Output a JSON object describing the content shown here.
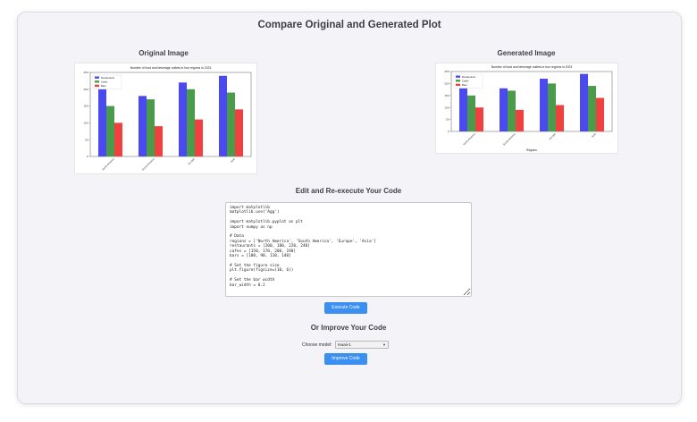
{
  "page": {
    "title": "Compare Original and Generated Plot"
  },
  "original": {
    "heading": "Original Image"
  },
  "generated": {
    "heading": "Generated Image"
  },
  "editor": {
    "heading": "Edit and Re-execute Your Code",
    "code": "import matplotlib\nmatplotlib.use('Agg')\n\nimport matplotlib.pyplot as plt\nimport numpy as np\n\n# Data\nregions = ['North America', 'South America', 'Europe', 'Asia']\nrestaurants = [200, 180, 220, 240]\ncafes = [150, 170, 200, 190]\nbars = [100, 90, 110, 140]\n\n# Set the figure size\nplt.figure(figsize=(10, 6))\n\n# Set the bar width\nbar_width = 0.2",
    "execute_label": "Execute Code"
  },
  "improve": {
    "heading": "Or Improve Your Code",
    "model_label": "Choose model:",
    "model_value": "Kwaii-1",
    "button_label": "Improve Code"
  },
  "chart_data": [
    {
      "type": "bar",
      "title": "Number of food and beverage outlets in four regions in 2023",
      "categories": [
        "North America",
        "South America",
        "Europe",
        "Asia"
      ],
      "series": [
        {
          "name": "Restaurants",
          "values": [
            200,
            180,
            220,
            240
          ],
          "color": "#4a4af0"
        },
        {
          "name": "Cafes",
          "values": [
            150,
            170,
            200,
            190
          ],
          "color": "#4a9c4a"
        },
        {
          "name": "Bars",
          "values": [
            100,
            90,
            110,
            140
          ],
          "color": "#f04040"
        }
      ],
      "yticks": [
        0,
        50,
        100,
        150,
        200,
        250
      ],
      "ylim": [
        0,
        250
      ],
      "xlabel": "",
      "legend": "top-left"
    },
    {
      "type": "bar",
      "title": "Number of food and beverage outlets in four regions in 2023",
      "categories": [
        "North America",
        "South America",
        "Europe",
        "Asia"
      ],
      "series": [
        {
          "name": "Restaurants",
          "values": [
            200,
            180,
            220,
            240
          ],
          "color": "#4a4af0"
        },
        {
          "name": "Cafes",
          "values": [
            150,
            170,
            200,
            190
          ],
          "color": "#4a9c4a"
        },
        {
          "name": "Bars",
          "values": [
            100,
            90,
            110,
            140
          ],
          "color": "#f04040"
        }
      ],
      "yticks": [
        0,
        50,
        100,
        150,
        200,
        250
      ],
      "ylim": [
        0,
        250
      ],
      "xlabel": "Regions",
      "legend": "top-left"
    }
  ]
}
